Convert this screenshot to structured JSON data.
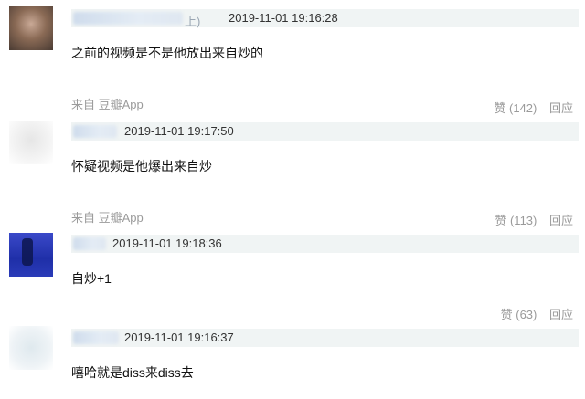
{
  "comments": [
    {
      "nick_tail": "上)",
      "timestamp": "2019-11-01 19:16:28",
      "text": "之前的视频是不是他放出来自炒的"
    },
    {
      "timestamp": "2019-11-01 19:17:50",
      "text": "怀疑视频是他爆出来自炒"
    },
    {
      "timestamp": "2019-11-01 19:18:36",
      "text": "自炒+1"
    },
    {
      "timestamp": "2019-11-01 19:16:37",
      "text": "嘻哈就是diss来diss去"
    }
  ],
  "footers": [
    {
      "source": "来自 豆瓣App",
      "like": "赞 (142)",
      "reply": "回应"
    },
    {
      "source": "来自 豆瓣App",
      "like": "赞 (113)",
      "reply": "回应"
    },
    {
      "like": "赞 (63)",
      "reply": "回应"
    }
  ]
}
